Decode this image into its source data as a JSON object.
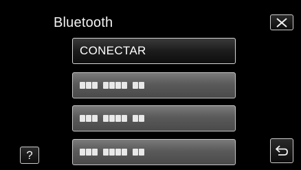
{
  "header": {
    "title": "Bluetooth"
  },
  "buttons": {
    "close_icon": "close-icon",
    "help_label": "?",
    "back_icon": "return-arrow-icon"
  },
  "menu": {
    "items": [
      {
        "label": "CONECTAR",
        "selected": true
      },
      {
        "label": "",
        "masked_groups": [
          3,
          4,
          2
        ]
      },
      {
        "label": "",
        "masked_groups": [
          3,
          4,
          2
        ]
      },
      {
        "label": "",
        "masked_groups": [
          3,
          4,
          2
        ]
      }
    ]
  },
  "colors": {
    "background": "#000000",
    "item_face": "#5a5a5a",
    "selected_item_face": "#1c1c1c",
    "border": "#c8c8c8",
    "text": "#ffffff"
  }
}
